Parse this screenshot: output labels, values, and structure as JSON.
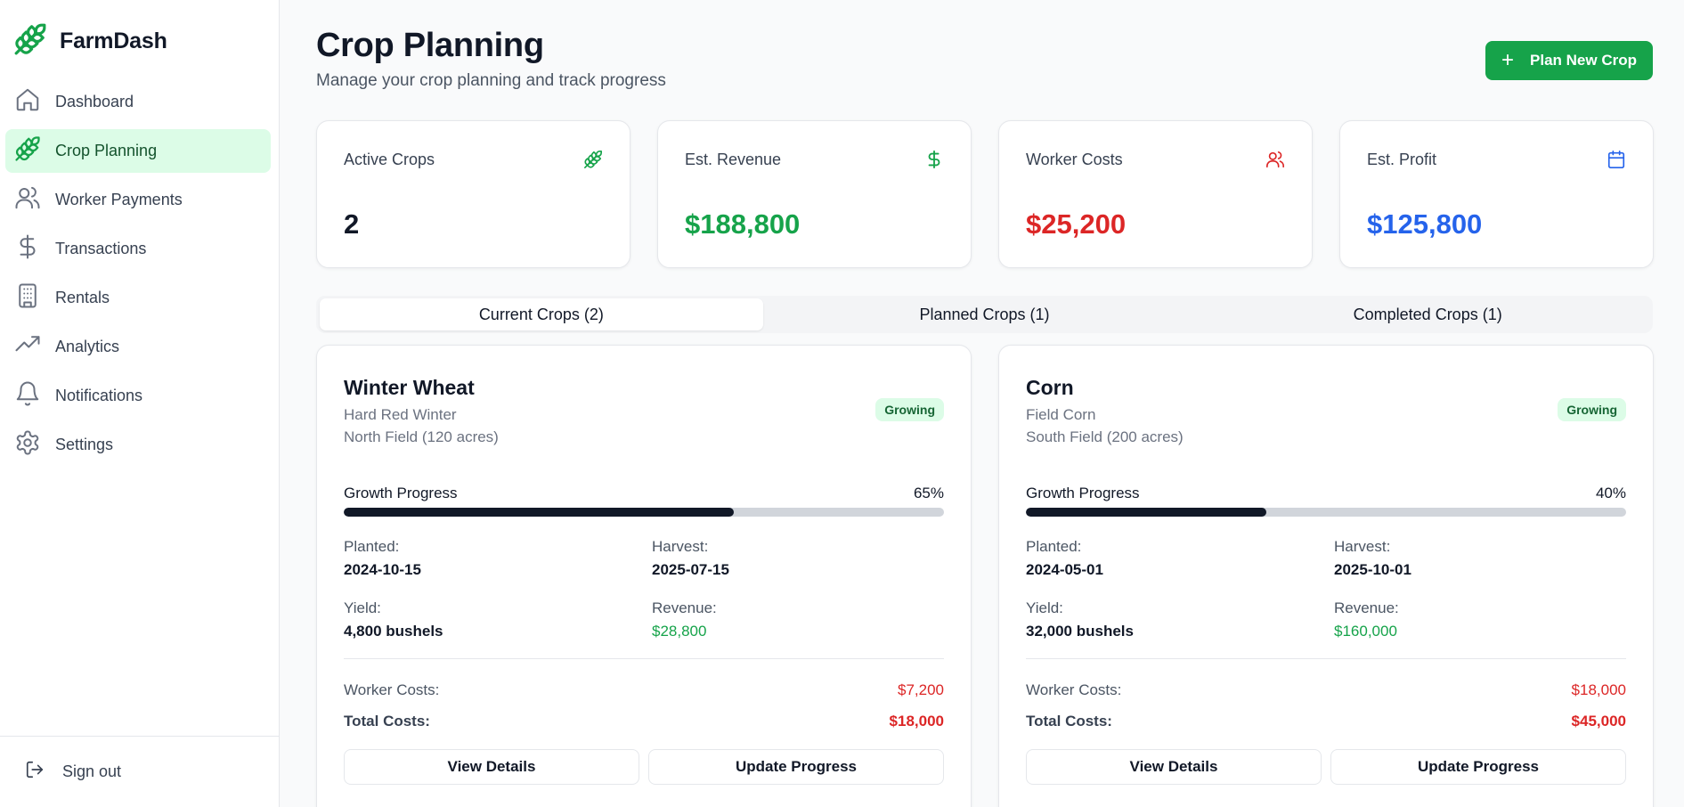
{
  "brand": {
    "name": "FarmDash",
    "icon": "wheat-icon",
    "accent": "#16a34a"
  },
  "sidebar": {
    "items": [
      {
        "label": "Dashboard",
        "icon": "home-icon",
        "active": false
      },
      {
        "label": "Crop Planning",
        "icon": "wheat-icon",
        "active": true
      },
      {
        "label": "Worker Payments",
        "icon": "users-icon",
        "active": false
      },
      {
        "label": "Transactions",
        "icon": "dollar-icon",
        "active": false
      },
      {
        "label": "Rentals",
        "icon": "building-icon",
        "active": false
      },
      {
        "label": "Analytics",
        "icon": "trending-up-icon",
        "active": false
      },
      {
        "label": "Notifications",
        "icon": "bell-icon",
        "active": false
      },
      {
        "label": "Settings",
        "icon": "gear-icon",
        "active": false
      }
    ],
    "signout": {
      "label": "Sign out",
      "icon": "logout-icon"
    }
  },
  "header": {
    "title": "Crop Planning",
    "subtitle": "Manage your crop planning and track progress",
    "primary_action": "Plan New Crop"
  },
  "stats": [
    {
      "label": "Active Crops",
      "value": "2",
      "icon": "wheat-icon",
      "color": "#111827",
      "icon_color": "#16a34a"
    },
    {
      "label": "Est. Revenue",
      "value": "$188,800",
      "icon": "dollar-icon",
      "color": "#16a34a",
      "icon_color": "#16a34a"
    },
    {
      "label": "Worker Costs",
      "value": "$25,200",
      "icon": "users-icon",
      "color": "#dc2626",
      "icon_color": "#dc2626"
    },
    {
      "label": "Est. Profit",
      "value": "$125,800",
      "icon": "calendar-icon",
      "color": "#2563eb",
      "icon_color": "#2563eb"
    }
  ],
  "tabs": [
    {
      "label": "Current Crops (2)",
      "active": true
    },
    {
      "label": "Planned Crops (1)",
      "active": false
    },
    {
      "label": "Completed Crops (1)",
      "active": false
    }
  ],
  "labels": {
    "growth_progress": "Growth Progress",
    "planted": "Planted:",
    "harvest": "Harvest:",
    "yield": "Yield:",
    "revenue": "Revenue:",
    "worker_costs": "Worker Costs:",
    "total_costs": "Total Costs:",
    "view_details": "View Details",
    "update_progress": "Update Progress"
  },
  "crops": [
    {
      "name": "Winter Wheat",
      "variety": "Hard Red Winter",
      "field": "North Field (120 acres)",
      "status": "Growing",
      "progress": 0.65,
      "progress_text": "65%",
      "planted": "2024-10-15",
      "harvest": "2025-07-15",
      "yield": "4,800 bushels",
      "revenue": "$28,800",
      "worker_costs": "$7,200",
      "total_costs": "$18,000"
    },
    {
      "name": "Corn",
      "variety": "Field Corn",
      "field": "South Field (200 acres)",
      "status": "Growing",
      "progress": 0.4,
      "progress_text": "40%",
      "planted": "2024-05-01",
      "harvest": "2025-10-01",
      "yield": "32,000 bushels",
      "revenue": "$160,000",
      "worker_costs": "$18,000",
      "total_costs": "$45,000"
    }
  ]
}
